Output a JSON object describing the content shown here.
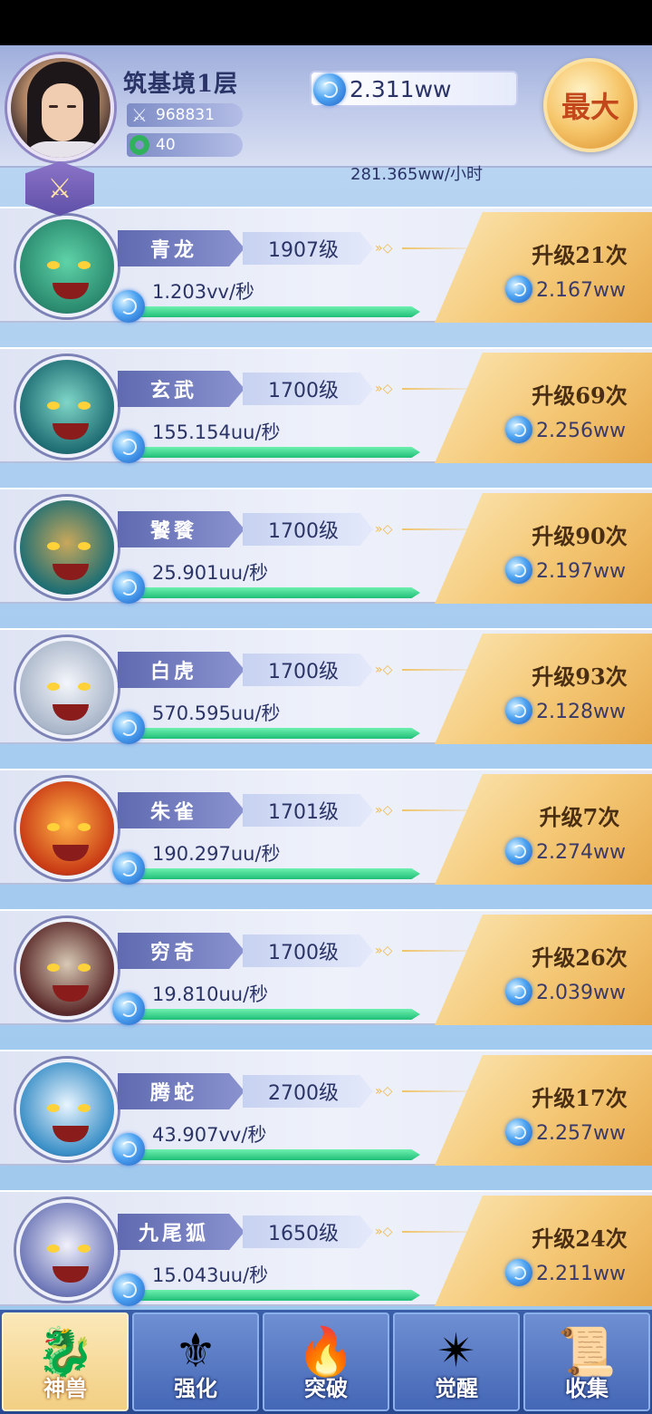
{
  "player": {
    "realm": "筑基境1层",
    "power": "968831",
    "jade": "40"
  },
  "currency": {
    "amount": "2.311ww",
    "rate": "281.365ww/小时"
  },
  "max_button": "最大",
  "beasts": [
    {
      "name": "青龙",
      "level": "1907级",
      "rate": "1.203vv/秒",
      "upgrade": "升级21次",
      "cost": "2.167ww",
      "progress": 1.0,
      "colors": [
        "#2a8a6e",
        "#5fd3a8"
      ]
    },
    {
      "name": "玄武",
      "level": "1700级",
      "rate": "155.154uu/秒",
      "upgrade": "升级69次",
      "cost": "2.256ww",
      "progress": 1.0,
      "colors": [
        "#1f6e74",
        "#7fd6c7"
      ]
    },
    {
      "name": "饕餮",
      "level": "1700级",
      "rate": "25.901uu/秒",
      "upgrade": "升级90次",
      "cost": "2.197ww",
      "progress": 1.0,
      "colors": [
        "#1f6f73",
        "#c9a85b"
      ]
    },
    {
      "name": "白虎",
      "level": "1700级",
      "rate": "570.595uu/秒",
      "upgrade": "升级93次",
      "cost": "2.128ww",
      "progress": 1.0,
      "colors": [
        "#a9b6c9",
        "#f4f6fb"
      ]
    },
    {
      "name": "朱雀",
      "level": "1701级",
      "rate": "190.297uu/秒",
      "upgrade": "升级7次",
      "cost": "2.274ww",
      "progress": 1.0,
      "colors": [
        "#c93a15",
        "#ffb347"
      ]
    },
    {
      "name": "穷奇",
      "level": "1700级",
      "rate": "19.810uu/秒",
      "upgrade": "升级26次",
      "cost": "2.039ww",
      "progress": 1.0,
      "colors": [
        "#5b2a2a",
        "#d8c9b4"
      ]
    },
    {
      "name": "腾蛇",
      "level": "2700级",
      "rate": "43.907vv/秒",
      "upgrade": "升级17次",
      "cost": "2.257ww",
      "progress": 1.0,
      "colors": [
        "#3a8fc7",
        "#e9f5ff"
      ]
    },
    {
      "name": "九尾狐",
      "level": "1650级",
      "rate": "15.043uu/秒",
      "upgrade": "升级24次",
      "cost": "2.211ww",
      "progress": 1.0,
      "colors": [
        "#6e78b8",
        "#f1f1fb"
      ]
    }
  ],
  "nav": [
    {
      "label": "神兽",
      "icon": "qilin-icon",
      "glyph": "🐉"
    },
    {
      "label": "强化",
      "icon": "helmet-icon",
      "glyph": "⚜"
    },
    {
      "label": "突破",
      "icon": "fire-orb-icon",
      "glyph": "🔥"
    },
    {
      "label": "觉醒",
      "icon": "eye-emblem-icon",
      "glyph": "✴"
    },
    {
      "label": "收集",
      "icon": "scroll-icon",
      "glyph": "📜"
    }
  ],
  "active_nav": 0
}
